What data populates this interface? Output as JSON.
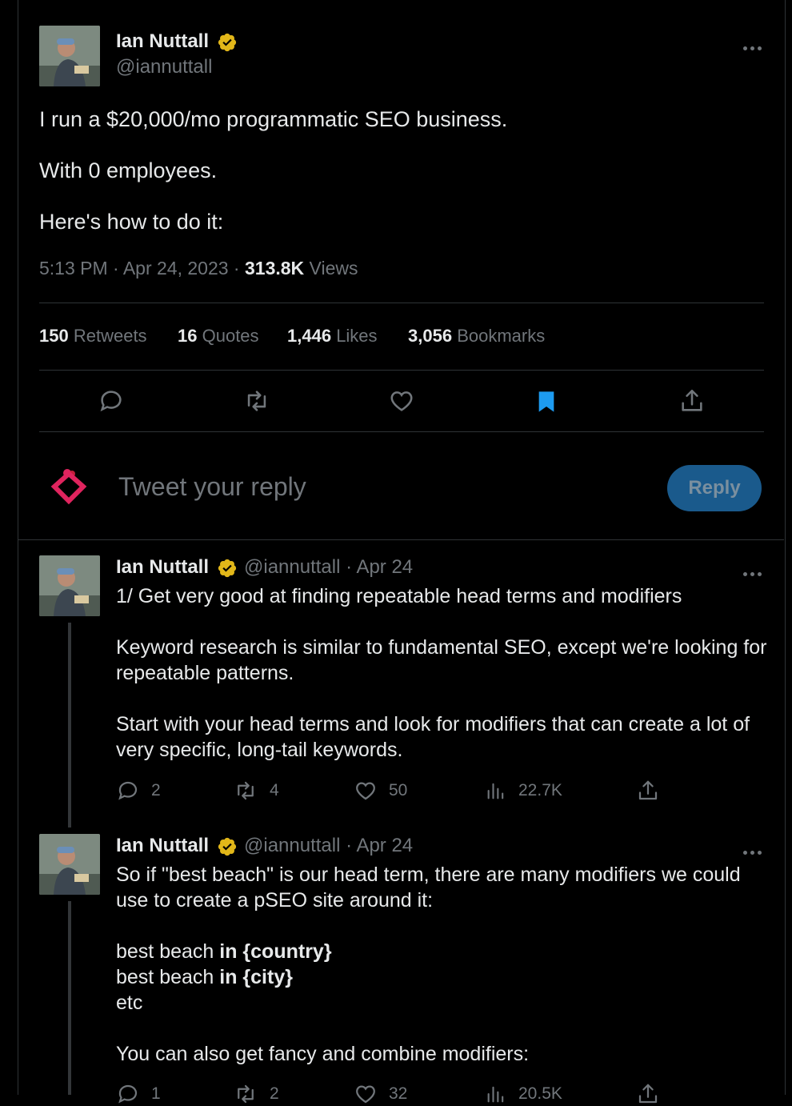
{
  "main_tweet": {
    "author_name": "Ian Nuttall",
    "author_handle": "@iannuttall",
    "lines": [
      "I run a $20,000/mo programmatic SEO business.",
      "With 0 employees.",
      "Here's how to do it:"
    ],
    "timestamp": "5:13 PM · Apr 24, 2023 · ",
    "views_count": "313.8K",
    "views_label": " Views",
    "stats": [
      {
        "count": "150",
        "label": "Retweets"
      },
      {
        "count": "16",
        "label": "Quotes"
      },
      {
        "count": "1,446",
        "label": "Likes"
      },
      {
        "count": "3,056",
        "label": "Bookmarks"
      }
    ]
  },
  "composer": {
    "placeholder": "Tweet your reply",
    "reply_label": "Reply"
  },
  "replies": [
    {
      "author_name": "Ian Nuttall",
      "author_handle": "@iannuttall · Apr 24",
      "paragraphs": [
        [
          "1/ Get very good at finding repeatable head terms and modifiers"
        ],
        [
          "Keyword research is similar to fundamental SEO, except we're looking for",
          "repeatable patterns."
        ],
        [
          "Start with your head terms and look for modifiers that can create a lot of",
          "very specific, long-tail keywords."
        ]
      ],
      "replies": "2",
      "retweets": "4",
      "likes": "50",
      "views": "22.7K"
    },
    {
      "author_name": "Ian Nuttall",
      "author_handle": "@iannuttall · Apr 24",
      "intro": [
        "So if \"best beach\" is our head term, there are many modifiers we could",
        "use to create a pSEO site around it:"
      ],
      "list": [
        {
          "plain": "best beach ",
          "bold": "in {country}"
        },
        {
          "plain": "best beach ",
          "bold": "in {city}"
        },
        {
          "plain": "etc",
          "bold": ""
        }
      ],
      "outro": "You can also get fancy and combine modifiers:",
      "replies": "1",
      "retweets": "2",
      "likes": "32",
      "views": "20.5K"
    }
  ],
  "colors": {
    "accent": "#1d9bf0",
    "verified": "#e2b719",
    "background": "#000000"
  }
}
